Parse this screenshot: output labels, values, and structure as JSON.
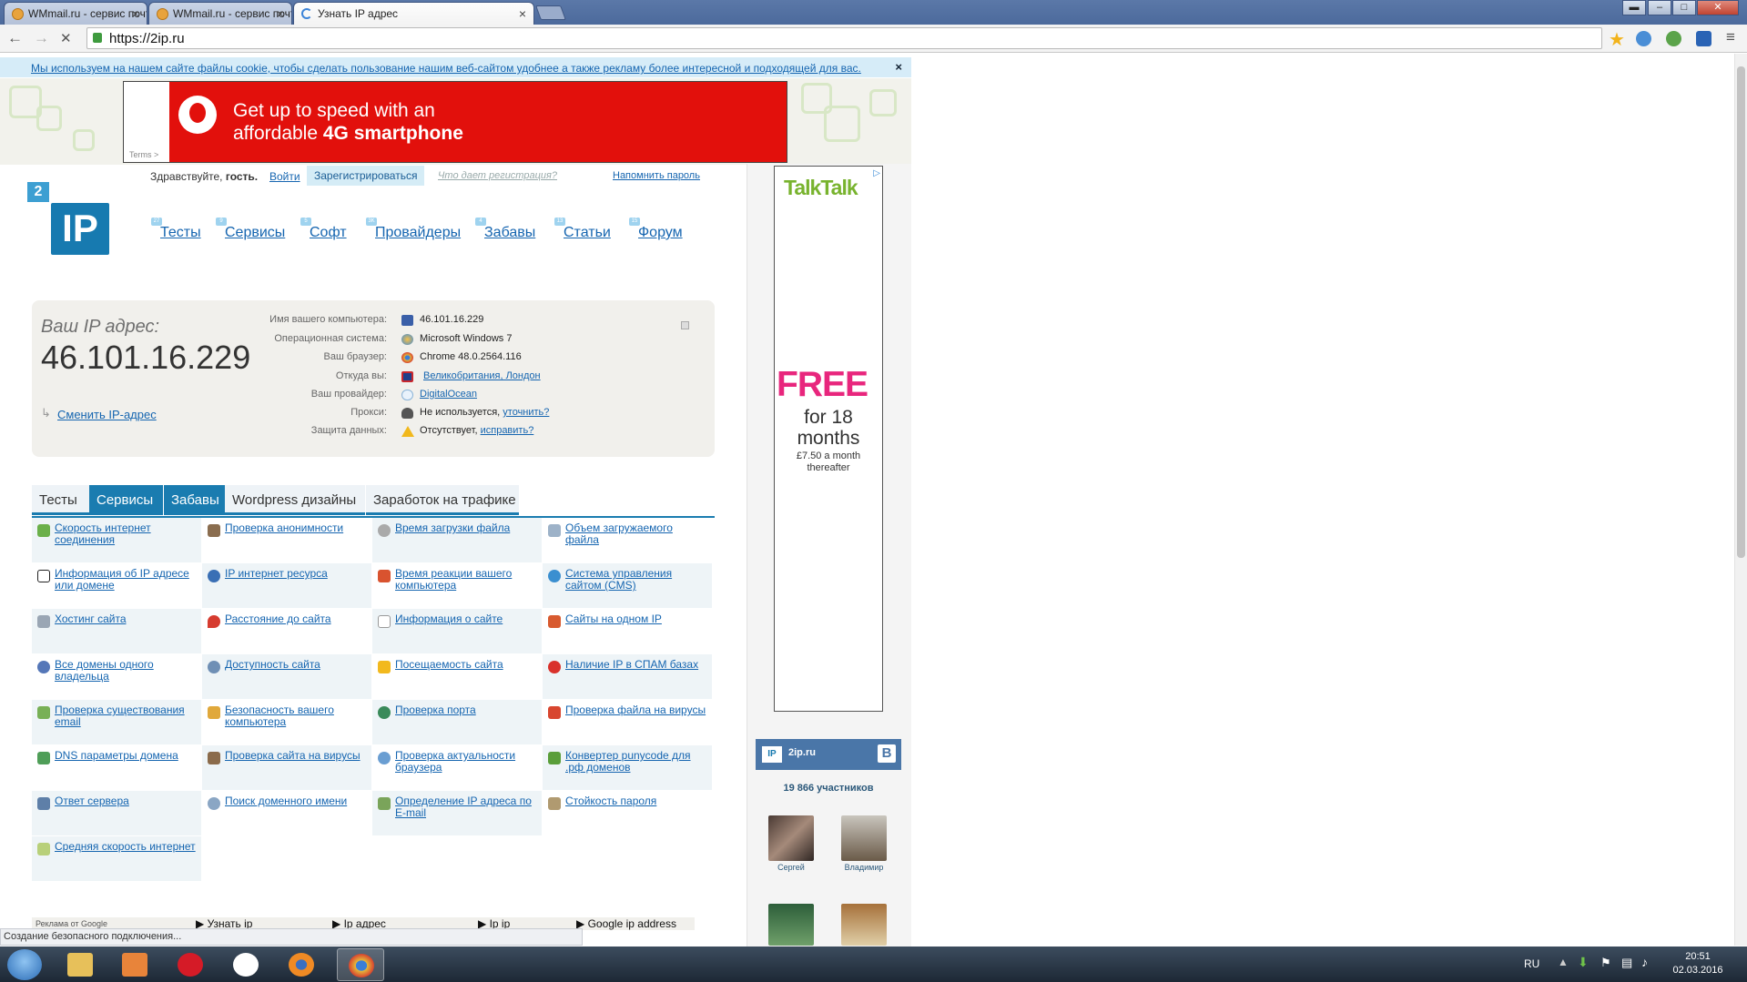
{
  "browser": {
    "tabs": [
      {
        "title": "WMmail.ru - сервис почто"
      },
      {
        "title": "WMmail.ru - сервис почто"
      },
      {
        "title": "Узнать IP адрес"
      }
    ],
    "url": "https://2ip.ru"
  },
  "cookie_notice": {
    "text": "Мы используем на нашем сайте файлы cookie, чтобы сделать пользование нашим веб-сайтом удобнее а также рекламу более интересной и подходящей для вас.",
    "close": "×"
  },
  "top_banner": {
    "line1": "Get up to speed with an",
    "line2_prefix": "affordable ",
    "line2_bold": "4G smartphone",
    "terms": "Terms >"
  },
  "login_bar": {
    "greeting": "Здравствуйте, ",
    "guest": "гость.",
    "login": "Войти",
    "register": "Зарегистрироваться",
    "why_register": "Что дает регистрация?",
    "remind_password": "Напомнить пароль"
  },
  "logo": {
    "badge": "2",
    "text": "IP"
  },
  "nav": [
    {
      "label": "Тесты",
      "count": "27"
    },
    {
      "label": "Сервисы",
      "count": "9"
    },
    {
      "label": "Софт",
      "count": "5"
    },
    {
      "label": "Провайдеры",
      "count": "3K"
    },
    {
      "label": "Забавы",
      "count": "4"
    },
    {
      "label": "Статьи",
      "count": "13"
    },
    {
      "label": "Форум",
      "count": "15"
    }
  ],
  "ip_info": {
    "label": "Ваш IP адрес:",
    "ip": "46.101.16.229",
    "change_ip": "Сменить IP-адрес",
    "rows": [
      {
        "key": "Имя вашего компьютера:",
        "value": "46.101.16.229",
        "link": false,
        "icon": "computer-icon"
      },
      {
        "key": "Операционная система:",
        "value": "Microsoft Windows 7",
        "link": false,
        "icon": "windows-icon"
      },
      {
        "key": "Ваш браузер:",
        "value": "Chrome 48.0.2564.116",
        "link": false,
        "icon": "chrome-icon"
      },
      {
        "key": "Откуда вы:",
        "value": "Великобритания, Лондон",
        "link": true,
        "icon": "uk-flag-icon"
      },
      {
        "key": "Ваш провайдер:",
        "value": "DigitalOcean",
        "link": true,
        "icon": "cloud-icon"
      },
      {
        "key": "Прокси:",
        "value": "Не используется, ",
        "extra_link": "уточнить?",
        "link": false,
        "icon": "glasses-icon"
      },
      {
        "key": "Защита данных:",
        "value": "Отсутствует, ",
        "extra_link": "исправить?",
        "link": false,
        "icon": "warning-icon"
      }
    ]
  },
  "section_tabs": [
    {
      "label": "Тесты"
    },
    {
      "label": "Сервисы"
    },
    {
      "label": "Забавы"
    },
    {
      "label": "Wordpress дизайны"
    },
    {
      "label": "Заработок на трафике"
    }
  ],
  "services": [
    [
      "Скорость интернет соединения",
      "Проверка анонимности",
      "Время загрузки файла",
      "Объем загружаемого файла"
    ],
    [
      "Информация об IP адресе или домене",
      "IP интернет ресурса",
      "Время реакции вашего компьютера",
      "Система управления сайтом (CMS)"
    ],
    [
      "Хостинг сайта",
      "Расстояние до сайта",
      "Информация о сайте",
      "Сайты на одном IP"
    ],
    [
      "Все домены одного владельца",
      "Доступность сайта",
      "Посещаемость сайта",
      "Наличие IP в СПАМ базах"
    ],
    [
      "Проверка существования email",
      "Безопасность вашего компьютера",
      "Проверка порта",
      "Проверка файла на вирусы"
    ],
    [
      "DNS параметры домена",
      "Проверка сайта на вирусы",
      "Проверка актуальности браузера",
      "Конвертер punycode для .рф доменов"
    ],
    [
      "Ответ сервера",
      "Поиск доменного имени",
      "Определение IP адреса по E-mail",
      "Стойкость пароля"
    ],
    [
      "Средняя скорость интернет"
    ]
  ],
  "ad_links": {
    "label": "Реклама от Google",
    "items": [
      "▶ Узнать ip",
      "▶ Ip адрес",
      "▶ Ip ip",
      "▶ Google ip address"
    ]
  },
  "status_text": "Создание безопасного подключения...",
  "side_banner": {
    "brand": "TalkTalk",
    "free": "FREE",
    "offer": "for 18 months",
    "price": "£7.50 a month thereafter"
  },
  "vk_widget": {
    "name": "2ip.ru",
    "button": "В",
    "members": "19 866 участников",
    "people": [
      "Сергей",
      "Владимир"
    ]
  },
  "taskbar": {
    "lang": "RU",
    "time": "20:51",
    "date": "02.03.2016"
  }
}
